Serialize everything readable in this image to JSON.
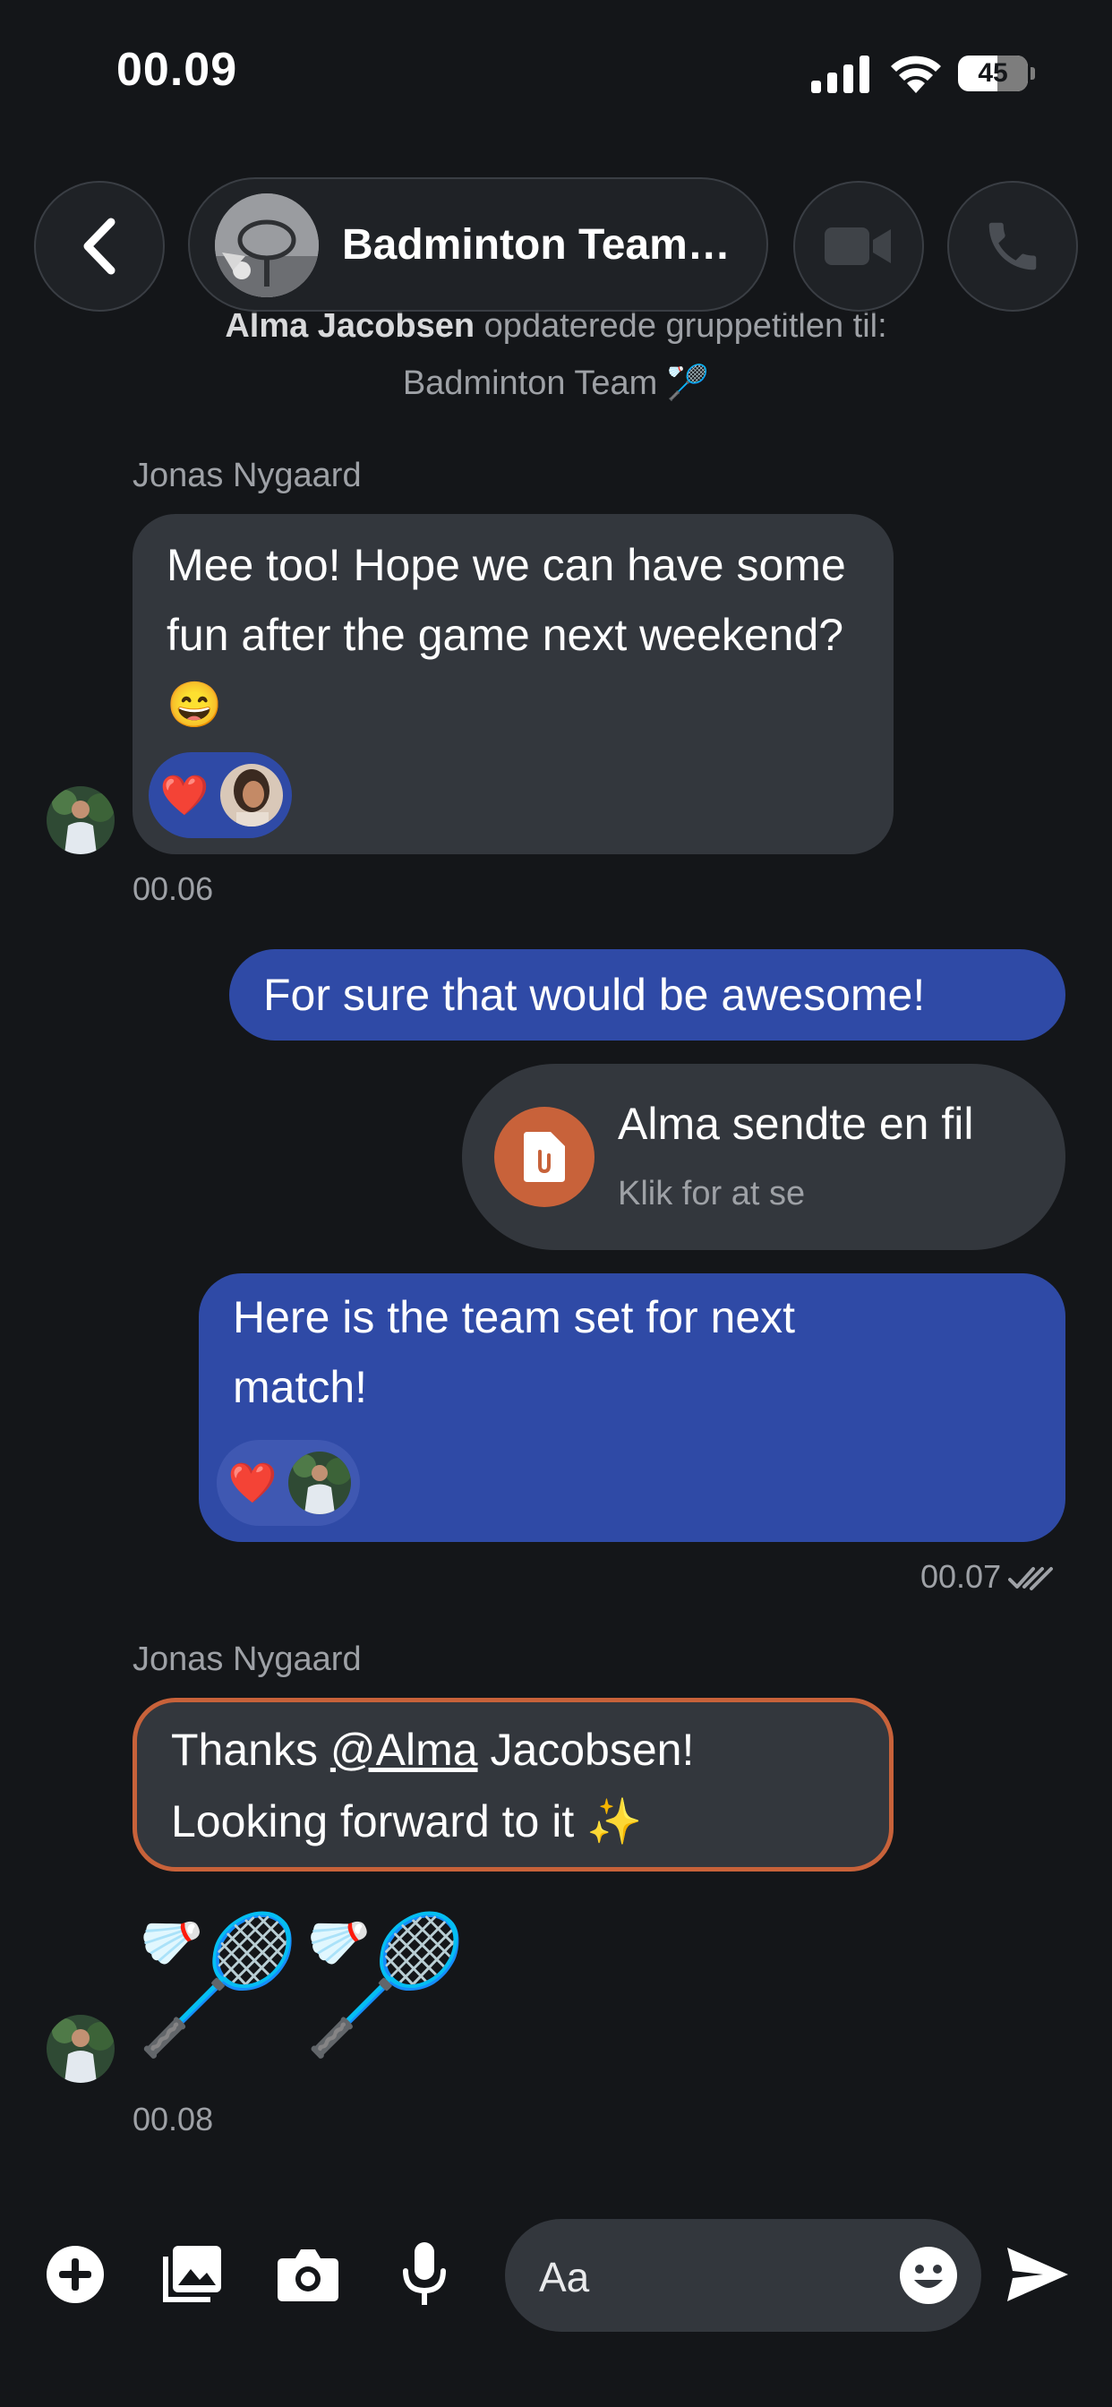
{
  "status_bar": {
    "time": "00.09",
    "battery": "45"
  },
  "header": {
    "title": "Badminton Team…",
    "back_icon": "chevron-left-icon",
    "video_icon": "video-camera-icon",
    "call_icon": "phone-icon"
  },
  "system_notice": {
    "actor": "Alma Jacobsen",
    "action": "opdaterede gruppetitlen til:",
    "new_title": "Badminton Team 🏸"
  },
  "messages": {
    "m1": {
      "sender": "Jonas Nygaard",
      "text": "Mee too! Hope we can have some fun after the game next weekend? 😄",
      "reaction": "❤️",
      "time": "00.06"
    },
    "m2": {
      "text": "For sure that would be awesome!"
    },
    "m3": {
      "file_title": "Alma sendte en fil",
      "file_subtitle": "Klik for at se"
    },
    "m4": {
      "text": "Here is the team set for next match!",
      "reaction": "❤️",
      "time": "00.07"
    },
    "m5": {
      "sender": "Jonas Nygaard",
      "text_before": "Thanks ",
      "mention": "@Alma",
      "text_after": " Jacobsen!",
      "line2": "Looking forward to it ✨"
    },
    "m6": {
      "emoji": "🏸🏸",
      "time": "00.08"
    }
  },
  "composer": {
    "placeholder": "Aa",
    "icons": [
      "plus-icon",
      "gallery-icon",
      "camera-icon",
      "microphone-icon",
      "emoji-icon",
      "send-icon"
    ]
  },
  "colors": {
    "background": "#141619",
    "incoming_bubble": "#33373d",
    "outgoing_bubble": "#2f4aa6",
    "mention_border": "#c8623a",
    "file_icon": "#c8623a"
  }
}
